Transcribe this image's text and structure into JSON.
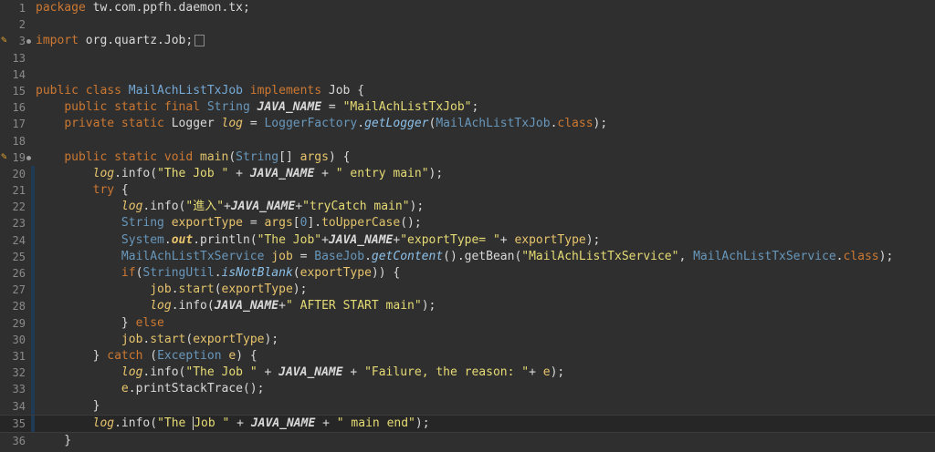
{
  "editor": {
    "lines": [
      {
        "n": "1",
        "tokens": [
          [
            "kw",
            "package"
          ],
          [
            "plain",
            " tw.com.ppfh.daemon.tx;"
          ]
        ]
      },
      {
        "n": "2",
        "tokens": []
      },
      {
        "n": "3",
        "marker": "warn",
        "fold": true,
        "tokens": [
          [
            "kw",
            "import"
          ],
          [
            "plain",
            " org.quartz.Job;"
          ]
        ],
        "collapsed": true
      },
      {
        "n": "13",
        "tokens": []
      },
      {
        "n": "14",
        "tokens": []
      },
      {
        "n": "15",
        "tokens": [
          [
            "kw",
            "public class "
          ],
          [
            "tyl",
            "MailAchListTxJob"
          ],
          [
            "kw",
            " implements "
          ],
          [
            "plain",
            "Job {"
          ]
        ]
      },
      {
        "n": "16",
        "tokens": [
          [
            "plain",
            "    "
          ],
          [
            "kw",
            "public static final "
          ],
          [
            "ty",
            "String "
          ],
          [
            "fit",
            "JAVA_NAME"
          ],
          [
            "plain",
            " = "
          ],
          [
            "st",
            "\"MailAchListTxJob\""
          ],
          [
            "plain",
            ";"
          ]
        ]
      },
      {
        "n": "17",
        "tokens": [
          [
            "plain",
            "    "
          ],
          [
            "kw",
            "private static "
          ],
          [
            "plain",
            "Logger "
          ],
          [
            "lg",
            "log"
          ],
          [
            "plain",
            " = "
          ],
          [
            "ty",
            "LoggerFactory"
          ],
          [
            "plain",
            "."
          ],
          [
            "mti",
            "getLogger"
          ],
          [
            "plain",
            "("
          ],
          [
            "ty",
            "MailAchListTxJob"
          ],
          [
            "plain",
            "."
          ],
          [
            "kw",
            "class"
          ],
          [
            "plain",
            ");"
          ]
        ]
      },
      {
        "n": "18",
        "tokens": []
      },
      {
        "n": "19",
        "marker": "warn",
        "fold": true,
        "tokens": [
          [
            "plain",
            "    "
          ],
          [
            "kw",
            "public static void "
          ],
          [
            "mt",
            "main"
          ],
          [
            "plain",
            "("
          ],
          [
            "ty",
            "String"
          ],
          [
            "plain",
            "[] "
          ],
          [
            "va",
            "args"
          ],
          [
            "plain",
            ") {"
          ]
        ]
      },
      {
        "n": "20",
        "bar": true,
        "tokens": [
          [
            "plain",
            "        "
          ],
          [
            "lg",
            "log"
          ],
          [
            "plain",
            ".info("
          ],
          [
            "st",
            "\"The Job \""
          ],
          [
            "plain",
            " + "
          ],
          [
            "fit",
            "JAVA_NAME"
          ],
          [
            "plain",
            " + "
          ],
          [
            "st",
            "\" entry main\""
          ],
          [
            "plain",
            ");"
          ]
        ]
      },
      {
        "n": "21",
        "bar": true,
        "tokens": [
          [
            "plain",
            "        "
          ],
          [
            "kw",
            "try"
          ],
          [
            "plain",
            " {"
          ]
        ]
      },
      {
        "n": "22",
        "bar": true,
        "tokens": [
          [
            "plain",
            "            "
          ],
          [
            "lg",
            "log"
          ],
          [
            "plain",
            ".info("
          ],
          [
            "st",
            "\"進入\""
          ],
          [
            "plain",
            "+"
          ],
          [
            "fit",
            "JAVA_NAME"
          ],
          [
            "plain",
            "+"
          ],
          [
            "st",
            "\"tryCatch main\""
          ],
          [
            "plain",
            ");"
          ]
        ]
      },
      {
        "n": "23",
        "bar": true,
        "tokens": [
          [
            "plain",
            "            "
          ],
          [
            "ty",
            "String "
          ],
          [
            "va",
            "exportType"
          ],
          [
            "plain",
            " = "
          ],
          [
            "va",
            "args"
          ],
          [
            "plain",
            "["
          ],
          [
            "ty",
            "0"
          ],
          [
            "plain",
            "]."
          ],
          [
            "mt",
            "toUpperCase"
          ],
          [
            "plain",
            "();"
          ]
        ]
      },
      {
        "n": "24",
        "bar": true,
        "tokens": [
          [
            "plain",
            "            "
          ],
          [
            "ty",
            "System"
          ],
          [
            "plain",
            "."
          ],
          [
            "fi",
            "out"
          ],
          [
            "plain",
            ".println("
          ],
          [
            "st",
            "\"The Job\""
          ],
          [
            "plain",
            "+"
          ],
          [
            "fit",
            "JAVA_NAME"
          ],
          [
            "plain",
            "+"
          ],
          [
            "st",
            "\"exportType= \""
          ],
          [
            "plain",
            "+ "
          ],
          [
            "va",
            "exportType"
          ],
          [
            "plain",
            ");"
          ]
        ]
      },
      {
        "n": "25",
        "bar": true,
        "tokens": [
          [
            "plain",
            "            "
          ],
          [
            "ty",
            "MailAchListTxService "
          ],
          [
            "va",
            "job"
          ],
          [
            "plain",
            " = "
          ],
          [
            "ty",
            "BaseJob"
          ],
          [
            "plain",
            "."
          ],
          [
            "mti",
            "getContent"
          ],
          [
            "plain",
            "().getBean("
          ],
          [
            "st",
            "\"MailAchListTxService\""
          ],
          [
            "plain",
            ", "
          ],
          [
            "ty",
            "MailAchListTxService"
          ],
          [
            "plain",
            "."
          ],
          [
            "kw",
            "class"
          ],
          [
            "plain",
            ");"
          ]
        ]
      },
      {
        "n": "26",
        "bar": true,
        "tokens": [
          [
            "plain",
            "            "
          ],
          [
            "kw",
            "if"
          ],
          [
            "plain",
            "("
          ],
          [
            "ty",
            "StringUtil"
          ],
          [
            "plain",
            "."
          ],
          [
            "mti",
            "isNotBlank"
          ],
          [
            "plain",
            "("
          ],
          [
            "va",
            "exportType"
          ],
          [
            "plain",
            ")) {"
          ]
        ]
      },
      {
        "n": "27",
        "bar": true,
        "tokens": [
          [
            "plain",
            "                "
          ],
          [
            "va",
            "job"
          ],
          [
            "plain",
            "."
          ],
          [
            "mt",
            "start"
          ],
          [
            "plain",
            "("
          ],
          [
            "va",
            "exportType"
          ],
          [
            "plain",
            ");"
          ]
        ]
      },
      {
        "n": "28",
        "bar": true,
        "tokens": [
          [
            "plain",
            "                "
          ],
          [
            "lg",
            "log"
          ],
          [
            "plain",
            ".info("
          ],
          [
            "fit",
            "JAVA_NAME"
          ],
          [
            "plain",
            "+"
          ],
          [
            "st",
            "\" AFTER START main\""
          ],
          [
            "plain",
            ");"
          ]
        ]
      },
      {
        "n": "29",
        "bar": true,
        "tokens": [
          [
            "plain",
            "            } "
          ],
          [
            "kw",
            "else"
          ]
        ]
      },
      {
        "n": "30",
        "bar": true,
        "tokens": [
          [
            "plain",
            "            "
          ],
          [
            "va",
            "job"
          ],
          [
            "plain",
            "."
          ],
          [
            "mt",
            "start"
          ],
          [
            "plain",
            "("
          ],
          [
            "va",
            "exportType"
          ],
          [
            "plain",
            ");"
          ]
        ]
      },
      {
        "n": "31",
        "bar": true,
        "tokens": [
          [
            "plain",
            "        } "
          ],
          [
            "kw",
            "catch"
          ],
          [
            "plain",
            " ("
          ],
          [
            "ty",
            "Exception "
          ],
          [
            "va",
            "e"
          ],
          [
            "plain",
            ") {"
          ]
        ]
      },
      {
        "n": "32",
        "bar": true,
        "tokens": [
          [
            "plain",
            "            "
          ],
          [
            "lg",
            "log"
          ],
          [
            "plain",
            ".info("
          ],
          [
            "st",
            "\"The Job \""
          ],
          [
            "plain",
            " + "
          ],
          [
            "fit",
            "JAVA_NAME"
          ],
          [
            "plain",
            " + "
          ],
          [
            "st",
            "\"Failure, the reason: \""
          ],
          [
            "plain",
            "+ "
          ],
          [
            "va",
            "e"
          ],
          [
            "plain",
            ");"
          ]
        ]
      },
      {
        "n": "33",
        "bar": true,
        "tokens": [
          [
            "plain",
            "            "
          ],
          [
            "va",
            "e"
          ],
          [
            "plain",
            ".printStackTrace();"
          ]
        ]
      },
      {
        "n": "34",
        "bar": true,
        "tokens": [
          [
            "plain",
            "        }"
          ]
        ]
      },
      {
        "n": "35",
        "bar": true,
        "current": true,
        "tokens": [
          [
            "plain",
            "        "
          ],
          [
            "lg",
            "log"
          ],
          [
            "plain",
            ".info("
          ],
          [
            "st",
            "\"The "
          ],
          [
            "caret",
            ""
          ],
          [
            "st",
            "Job \""
          ],
          [
            "plain",
            " + "
          ],
          [
            "fit",
            "JAVA_NAME"
          ],
          [
            "plain",
            " + "
          ],
          [
            "st",
            "\" main end\""
          ],
          [
            "plain",
            ");"
          ]
        ]
      },
      {
        "n": "36",
        "tokens": [
          [
            "plain",
            "    }"
          ]
        ]
      }
    ]
  }
}
